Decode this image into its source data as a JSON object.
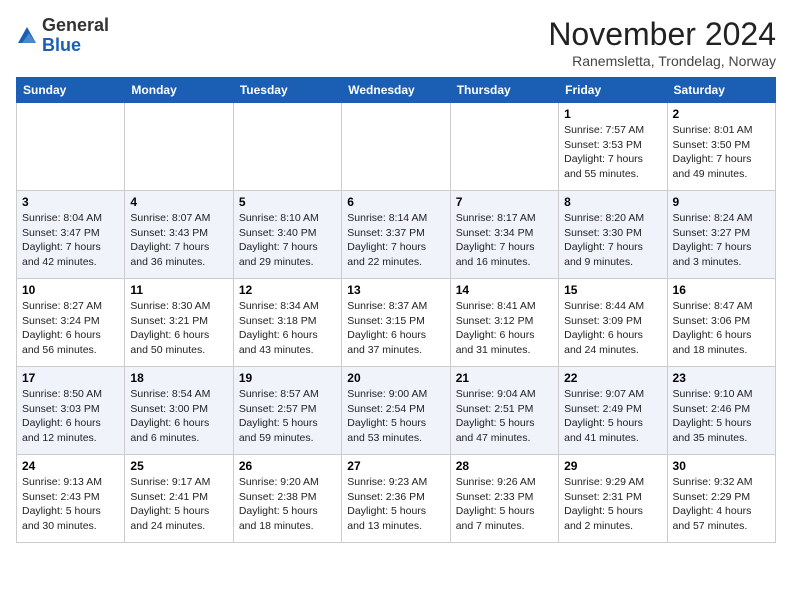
{
  "header": {
    "logo_general": "General",
    "logo_blue": "Blue",
    "month_title": "November 2024",
    "location": "Ranemsletta, Trondelag, Norway"
  },
  "weekdays": [
    "Sunday",
    "Monday",
    "Tuesday",
    "Wednesday",
    "Thursday",
    "Friday",
    "Saturday"
  ],
  "weeks": [
    [
      {
        "day": "",
        "info": ""
      },
      {
        "day": "",
        "info": ""
      },
      {
        "day": "",
        "info": ""
      },
      {
        "day": "",
        "info": ""
      },
      {
        "day": "",
        "info": ""
      },
      {
        "day": "1",
        "info": "Sunrise: 7:57 AM\nSunset: 3:53 PM\nDaylight: 7 hours\nand 55 minutes."
      },
      {
        "day": "2",
        "info": "Sunrise: 8:01 AM\nSunset: 3:50 PM\nDaylight: 7 hours\nand 49 minutes."
      }
    ],
    [
      {
        "day": "3",
        "info": "Sunrise: 8:04 AM\nSunset: 3:47 PM\nDaylight: 7 hours\nand 42 minutes."
      },
      {
        "day": "4",
        "info": "Sunrise: 8:07 AM\nSunset: 3:43 PM\nDaylight: 7 hours\nand 36 minutes."
      },
      {
        "day": "5",
        "info": "Sunrise: 8:10 AM\nSunset: 3:40 PM\nDaylight: 7 hours\nand 29 minutes."
      },
      {
        "day": "6",
        "info": "Sunrise: 8:14 AM\nSunset: 3:37 PM\nDaylight: 7 hours\nand 22 minutes."
      },
      {
        "day": "7",
        "info": "Sunrise: 8:17 AM\nSunset: 3:34 PM\nDaylight: 7 hours\nand 16 minutes."
      },
      {
        "day": "8",
        "info": "Sunrise: 8:20 AM\nSunset: 3:30 PM\nDaylight: 7 hours\nand 9 minutes."
      },
      {
        "day": "9",
        "info": "Sunrise: 8:24 AM\nSunset: 3:27 PM\nDaylight: 7 hours\nand 3 minutes."
      }
    ],
    [
      {
        "day": "10",
        "info": "Sunrise: 8:27 AM\nSunset: 3:24 PM\nDaylight: 6 hours\nand 56 minutes."
      },
      {
        "day": "11",
        "info": "Sunrise: 8:30 AM\nSunset: 3:21 PM\nDaylight: 6 hours\nand 50 minutes."
      },
      {
        "day": "12",
        "info": "Sunrise: 8:34 AM\nSunset: 3:18 PM\nDaylight: 6 hours\nand 43 minutes."
      },
      {
        "day": "13",
        "info": "Sunrise: 8:37 AM\nSunset: 3:15 PM\nDaylight: 6 hours\nand 37 minutes."
      },
      {
        "day": "14",
        "info": "Sunrise: 8:41 AM\nSunset: 3:12 PM\nDaylight: 6 hours\nand 31 minutes."
      },
      {
        "day": "15",
        "info": "Sunrise: 8:44 AM\nSunset: 3:09 PM\nDaylight: 6 hours\nand 24 minutes."
      },
      {
        "day": "16",
        "info": "Sunrise: 8:47 AM\nSunset: 3:06 PM\nDaylight: 6 hours\nand 18 minutes."
      }
    ],
    [
      {
        "day": "17",
        "info": "Sunrise: 8:50 AM\nSunset: 3:03 PM\nDaylight: 6 hours\nand 12 minutes."
      },
      {
        "day": "18",
        "info": "Sunrise: 8:54 AM\nSunset: 3:00 PM\nDaylight: 6 hours\nand 6 minutes."
      },
      {
        "day": "19",
        "info": "Sunrise: 8:57 AM\nSunset: 2:57 PM\nDaylight: 5 hours\nand 59 minutes."
      },
      {
        "day": "20",
        "info": "Sunrise: 9:00 AM\nSunset: 2:54 PM\nDaylight: 5 hours\nand 53 minutes."
      },
      {
        "day": "21",
        "info": "Sunrise: 9:04 AM\nSunset: 2:51 PM\nDaylight: 5 hours\nand 47 minutes."
      },
      {
        "day": "22",
        "info": "Sunrise: 9:07 AM\nSunset: 2:49 PM\nDaylight: 5 hours\nand 41 minutes."
      },
      {
        "day": "23",
        "info": "Sunrise: 9:10 AM\nSunset: 2:46 PM\nDaylight: 5 hours\nand 35 minutes."
      }
    ],
    [
      {
        "day": "24",
        "info": "Sunrise: 9:13 AM\nSunset: 2:43 PM\nDaylight: 5 hours\nand 30 minutes."
      },
      {
        "day": "25",
        "info": "Sunrise: 9:17 AM\nSunset: 2:41 PM\nDaylight: 5 hours\nand 24 minutes."
      },
      {
        "day": "26",
        "info": "Sunrise: 9:20 AM\nSunset: 2:38 PM\nDaylight: 5 hours\nand 18 minutes."
      },
      {
        "day": "27",
        "info": "Sunrise: 9:23 AM\nSunset: 2:36 PM\nDaylight: 5 hours\nand 13 minutes."
      },
      {
        "day": "28",
        "info": "Sunrise: 9:26 AM\nSunset: 2:33 PM\nDaylight: 5 hours\nand 7 minutes."
      },
      {
        "day": "29",
        "info": "Sunrise: 9:29 AM\nSunset: 2:31 PM\nDaylight: 5 hours\nand 2 minutes."
      },
      {
        "day": "30",
        "info": "Sunrise: 9:32 AM\nSunset: 2:29 PM\nDaylight: 4 hours\nand 57 minutes."
      }
    ]
  ]
}
